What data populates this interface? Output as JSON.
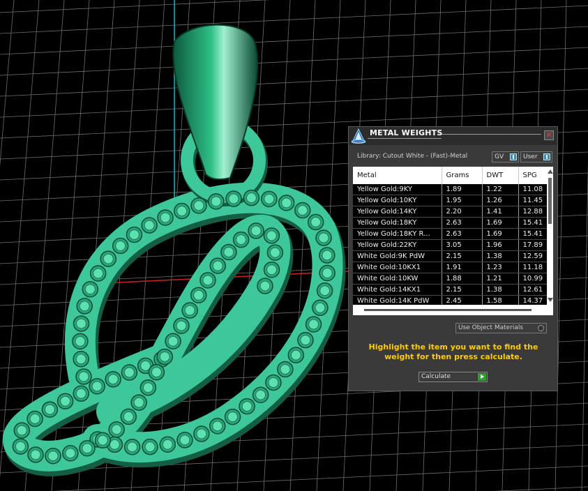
{
  "viewport": {
    "background": "#000000",
    "grid_color": "#6e6e6e",
    "axis_x_color": "#d02020",
    "axis_y_color": "#20b0c8",
    "model_color": "#3ec79a",
    "model_name": "letter-d-pendant"
  },
  "panel": {
    "title": "METAL WEIGHTS",
    "logo_icon": "app-logo-icon",
    "close_label": "✕",
    "library_label": "Library: Cutout White - (Fast)-Metal",
    "toggles": {
      "gv": "GV",
      "user": "User"
    },
    "columns": [
      "Metal",
      "Grams",
      "DWT",
      "SPG"
    ],
    "rows": [
      [
        "Yellow Gold:9KY",
        "1.89",
        "1.22",
        "11.08"
      ],
      [
        "Yellow Gold:10KY",
        "1.95",
        "1.26",
        "11.45"
      ],
      [
        "Yellow Gold:14KY",
        "2.20",
        "1.41",
        "12.88"
      ],
      [
        "Yellow Gold:18KY",
        "2.63",
        "1.69",
        "15.41"
      ],
      [
        "Yellow Gold:18KY R...",
        "2.63",
        "1.69",
        "15.41"
      ],
      [
        "Yellow Gold:22KY",
        "3.05",
        "1.96",
        "17.89"
      ],
      [
        "White Gold:9K PdW",
        "2.15",
        "1.38",
        "12.59"
      ],
      [
        "White Gold:10KX1",
        "1.91",
        "1.23",
        "11.18"
      ],
      [
        "White Gold:10KW",
        "1.88",
        "1.21",
        "10.99"
      ],
      [
        "White Gold:14KX1",
        "2.15",
        "1.38",
        "12.61"
      ],
      [
        "White Gold:14K PdW",
        "2.45",
        "1.58",
        "14.37"
      ]
    ],
    "use_object_materials": "Use Object Materials",
    "hint": "Highlight the item you want to find the weight for then press calculate.",
    "calculate_label": "Calculate",
    "accent": "#ffcc00"
  }
}
